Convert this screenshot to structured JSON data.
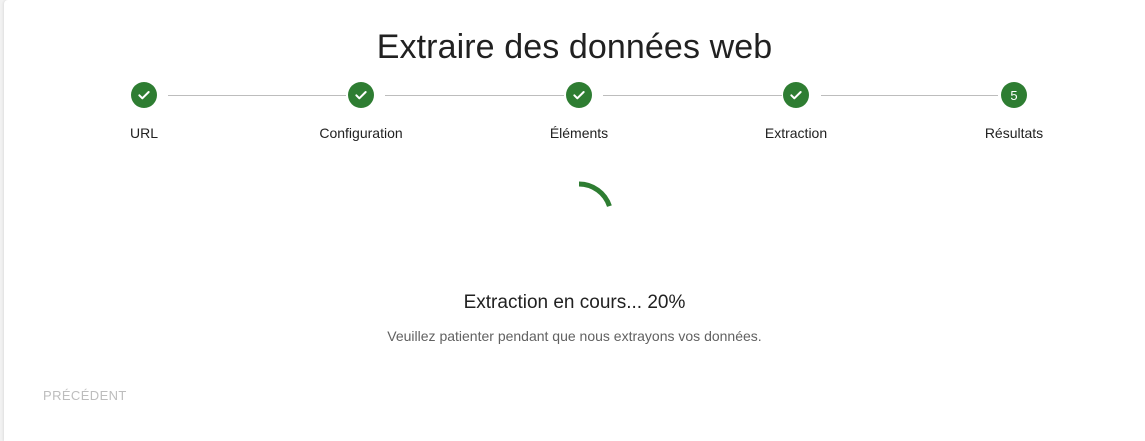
{
  "title": "Extraire des données web",
  "colors": {
    "accent": "#2e7d32",
    "connector": "#bdbdbd",
    "disabled": "#bdbdbd"
  },
  "stepper": {
    "steps": [
      {
        "label": "URL",
        "state": "completed",
        "icon": "check-icon"
      },
      {
        "label": "Configuration",
        "state": "completed",
        "icon": "check-icon"
      },
      {
        "label": "Éléments",
        "state": "completed",
        "icon": "check-icon"
      },
      {
        "label": "Extraction",
        "state": "completed",
        "icon": "check-icon"
      },
      {
        "label": "Résultats",
        "state": "active",
        "number": "5"
      }
    ]
  },
  "progress": {
    "percent": 20,
    "status_text": "Extraction en cours... 20%",
    "subtext": "Veuillez patienter pendant que nous extrayons vos données."
  },
  "navigation": {
    "previous_label": "Précédent",
    "previous_disabled": true
  }
}
